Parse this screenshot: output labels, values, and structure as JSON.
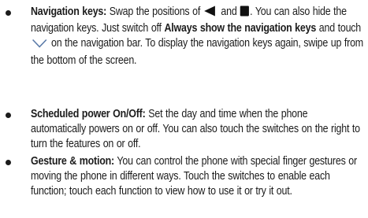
{
  "items": [
    {
      "term": "Navigation keys:",
      "seg1": " Swap the positions of ",
      "icon1": "back-triangle-icon",
      "seg2": " and ",
      "icon2": "square-key-icon",
      "seg3": ". You can also hide the navigation keys. Just switch off ",
      "bold2": "Always show the navigation keys",
      "seg4": " and touch ",
      "icon3": "chevron-down-icon",
      "seg5": " on the navigation bar. To display the navigation keys again, swipe up from the bottom of the screen."
    },
    {
      "term": "Scheduled power On/Off:",
      "body": " Set the day and time when the phone automatically powers on or off. You can also touch the switches on the right to turn the features on or off."
    },
    {
      "term": "Gesture & motion:",
      "body": " You can control the phone with special finger gestures or moving the phone in different ways. Touch the switches to enable each function; touch each function to view how to use it or try it out."
    }
  ],
  "colors": {
    "text": "#1c1c1c",
    "icon": "#111111",
    "chevron": "#5a7aa8"
  }
}
